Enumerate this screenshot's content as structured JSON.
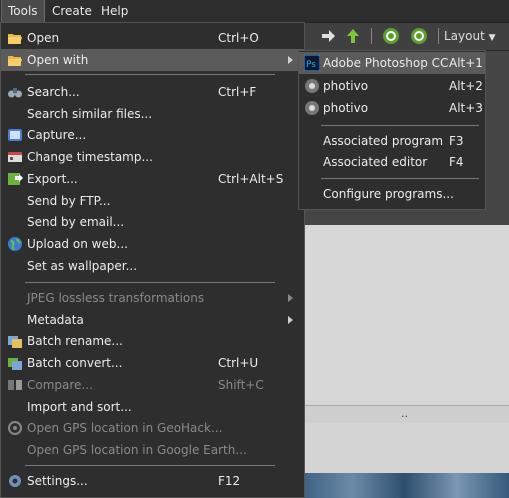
{
  "menubar": {
    "items": [
      {
        "label": "Tools"
      },
      {
        "label": "Create"
      },
      {
        "label": "Help"
      }
    ]
  },
  "toolbar": {
    "layout_label": "Layout"
  },
  "preview": {
    "bar_text": ".."
  },
  "tools_menu": {
    "items": [
      {
        "label": "Open",
        "shortcut": "Ctrl+O",
        "icon": "folder-open-icon"
      },
      {
        "label": "Open with",
        "shortcut": "",
        "icon": "folder-open-with-icon"
      },
      {
        "label": "Search...",
        "shortcut": "Ctrl+F",
        "icon": "binoculars-icon"
      },
      {
        "label": "Search similar files...",
        "shortcut": "",
        "icon": ""
      },
      {
        "label": "Capture...",
        "shortcut": "",
        "icon": "capture-icon"
      },
      {
        "label": "Change timestamp...",
        "shortcut": "",
        "icon": "timestamp-icon"
      },
      {
        "label": "Export...",
        "shortcut": "Ctrl+Alt+S",
        "icon": "export-icon"
      },
      {
        "label": "Send by FTP...",
        "shortcut": "",
        "icon": ""
      },
      {
        "label": "Send by email...",
        "shortcut": "",
        "icon": ""
      },
      {
        "label": "Upload on web...",
        "shortcut": "",
        "icon": "globe-icon"
      },
      {
        "label": "Set as wallpaper...",
        "shortcut": "",
        "icon": ""
      },
      {
        "label": "JPEG lossless transformations",
        "shortcut": "",
        "icon": ""
      },
      {
        "label": "Metadata",
        "shortcut": "",
        "icon": ""
      },
      {
        "label": "Batch rename...",
        "shortcut": "",
        "icon": "batch-rename-icon"
      },
      {
        "label": "Batch convert...",
        "shortcut": "Ctrl+U",
        "icon": "batch-convert-icon"
      },
      {
        "label": "Compare...",
        "shortcut": "Shift+C",
        "icon": "compare-icon"
      },
      {
        "label": "Import and sort...",
        "shortcut": "",
        "icon": ""
      },
      {
        "label": "Open GPS location in GeoHack...",
        "shortcut": "",
        "icon": "gps-icon"
      },
      {
        "label": "Open GPS location in Google Earth...",
        "shortcut": "",
        "icon": ""
      },
      {
        "label": "Settings...",
        "shortcut": "F12",
        "icon": "gear-icon"
      }
    ]
  },
  "open_with_menu": {
    "items": [
      {
        "label": "Adobe Photoshop CC",
        "shortcut": "Alt+1",
        "icon": "photoshop-icon"
      },
      {
        "label": "photivo",
        "shortcut": "Alt+2",
        "icon": "photivo-icon"
      },
      {
        "label": "photivo",
        "shortcut": "Alt+3",
        "icon": "photivo-icon"
      },
      {
        "label": "Associated program",
        "shortcut": "F3",
        "icon": ""
      },
      {
        "label": "Associated editor",
        "shortcut": "F4",
        "icon": ""
      },
      {
        "label": "Configure programs...",
        "shortcut": "",
        "icon": ""
      }
    ]
  }
}
